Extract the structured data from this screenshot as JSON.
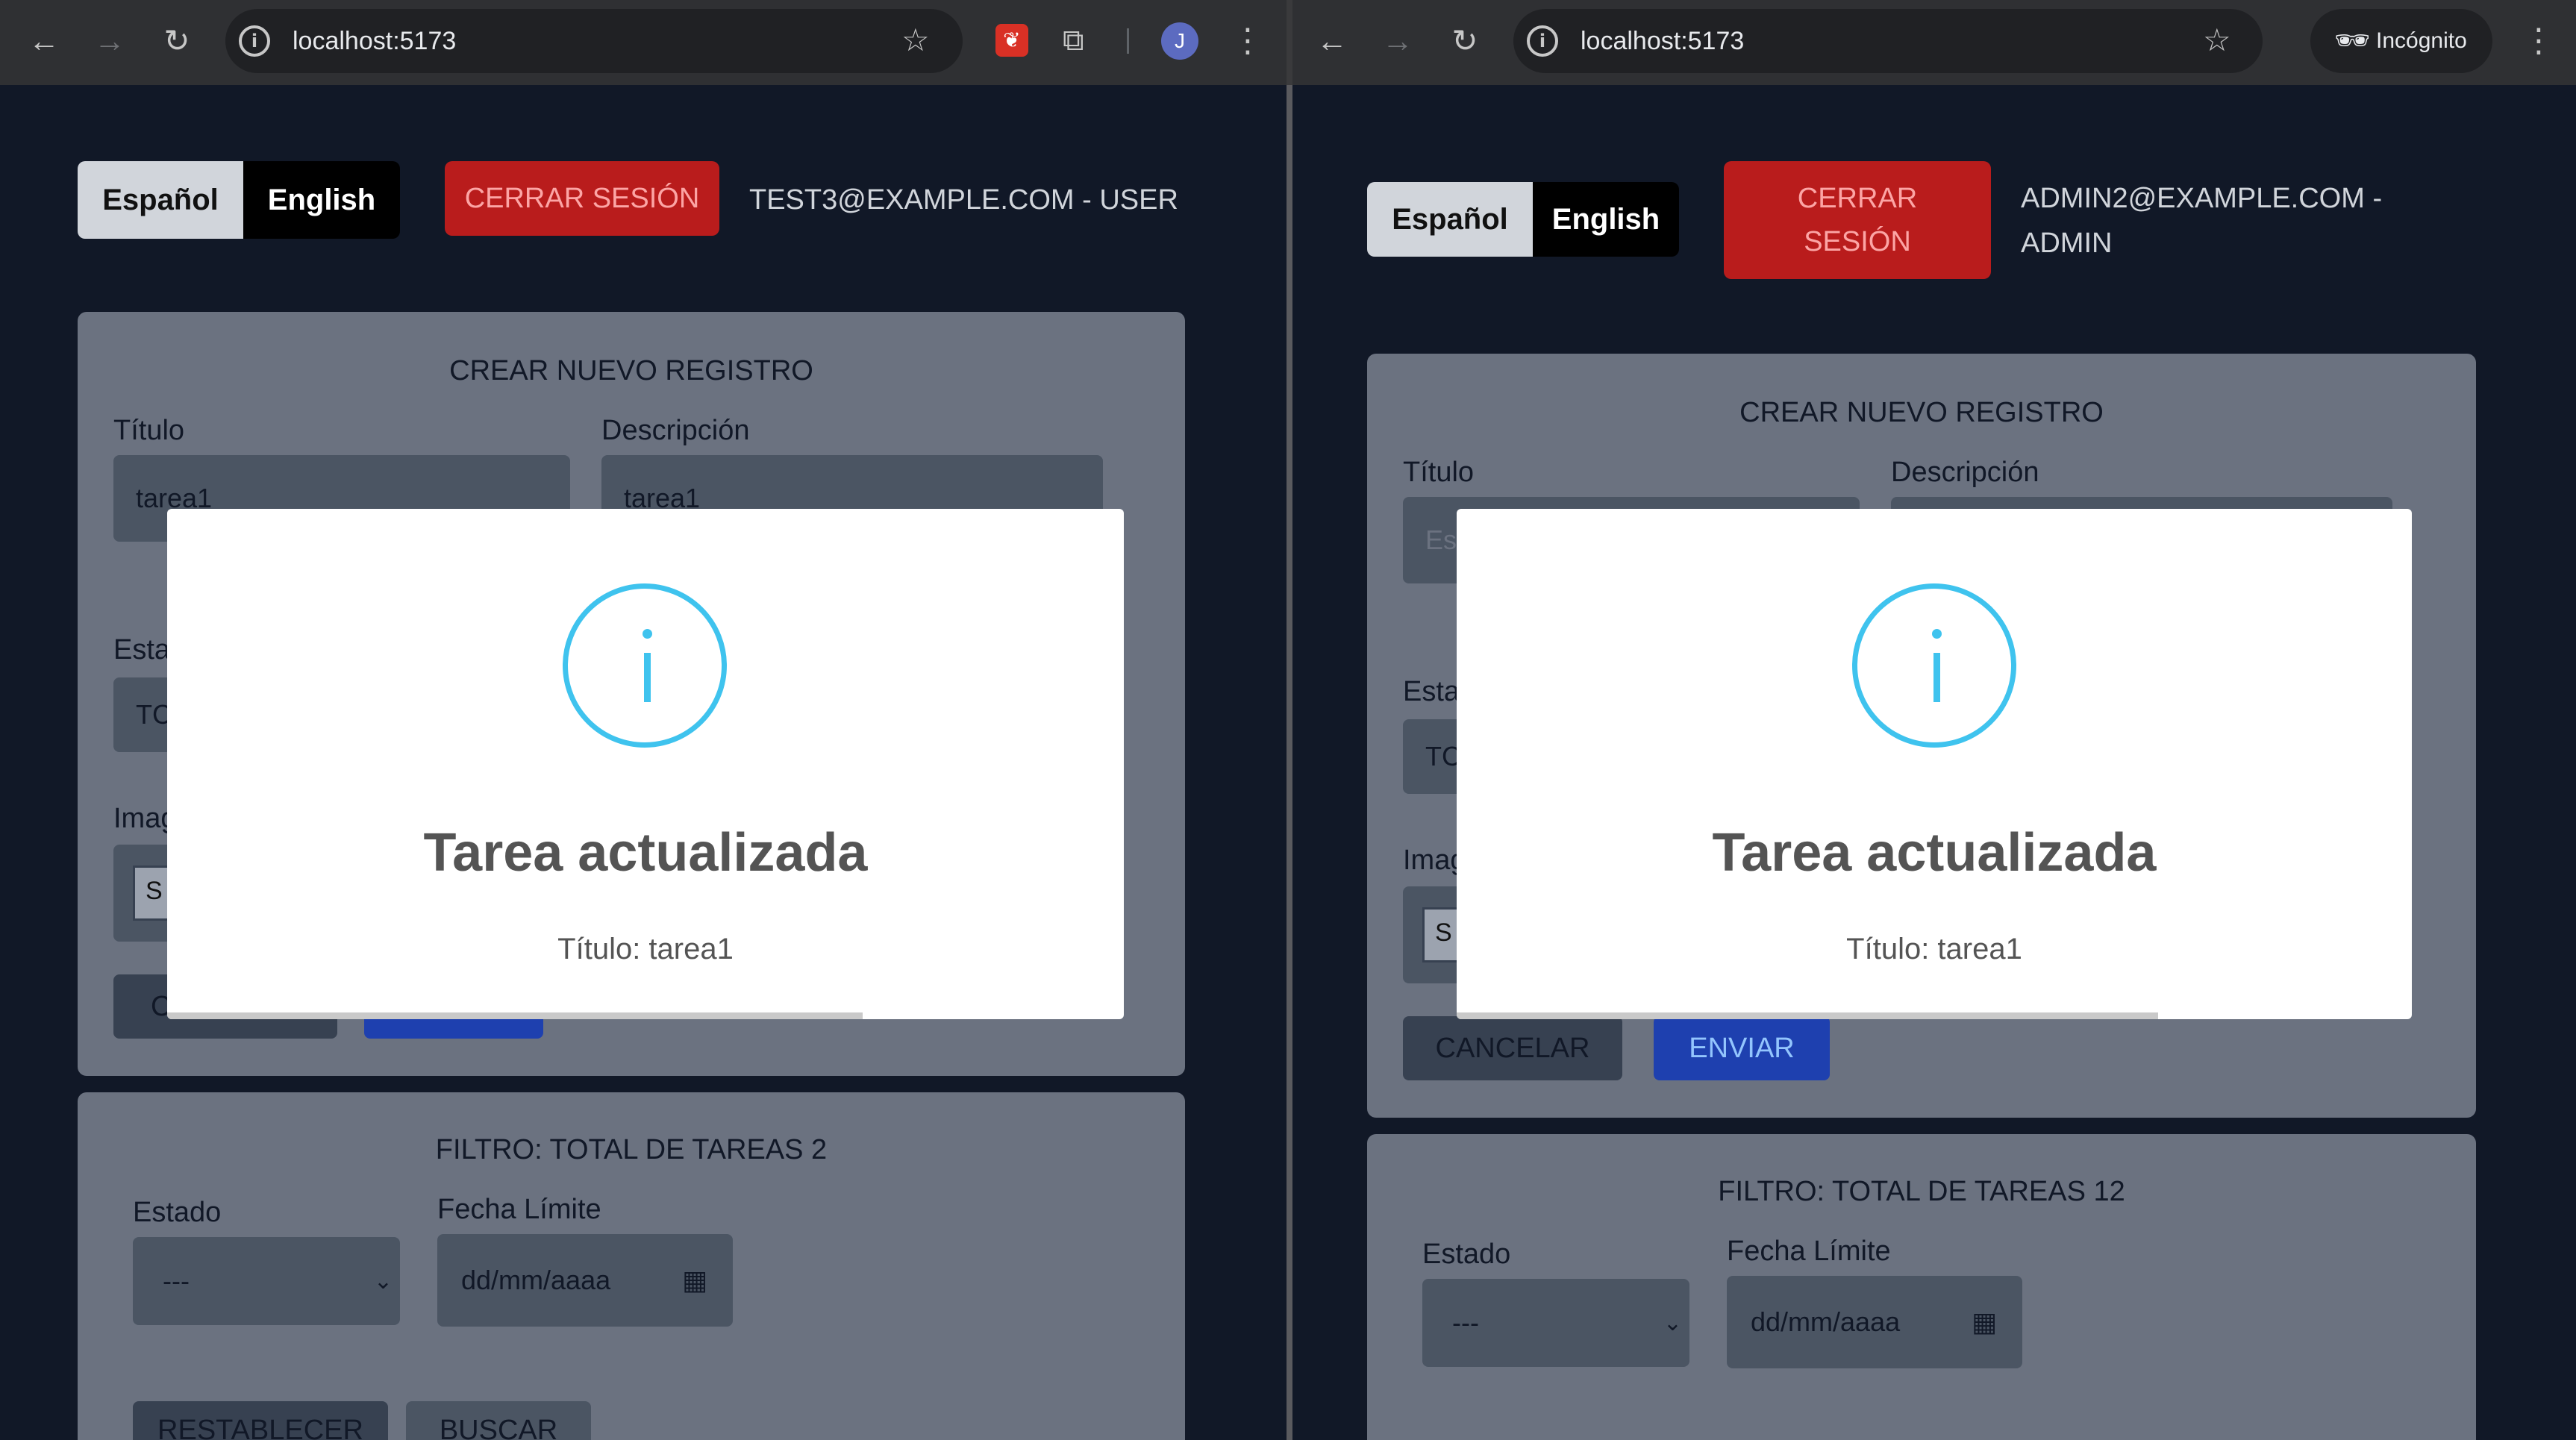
{
  "left": {
    "url": "localhost:5173",
    "profile_initial": "J",
    "lang_es": "Español",
    "lang_en": "English",
    "logout": "CERRAR SESIÓN",
    "user": "TEST3@EXAMPLE.COM - USER",
    "form": {
      "title": "CREAR NUEVO REGISTRO",
      "titulo_label": "Título",
      "titulo_value": "tarea1",
      "desc_label": "Descripción",
      "desc_value": "tarea1",
      "estado_label": "Esta",
      "estado_value": "TC",
      "imagen_label": "Imag",
      "file_btn": "S",
      "cancel_btn": "C"
    },
    "filter": {
      "title": "FILTRO: TOTAL DE TAREAS 2",
      "estado_label": "Estado",
      "estado_value": "---",
      "fecha_label": "Fecha Límite",
      "fecha_placeholder": "dd/mm/aaaa",
      "reset_btn": "RESTABLECER",
      "search_btn": "BUSCAR"
    },
    "modal": {
      "title": "Tarea actualizada",
      "text": "Título: tarea1"
    }
  },
  "right": {
    "url": "localhost:5173",
    "incognito": "Incógnito",
    "lang_es": "Español",
    "lang_en": "English",
    "logout_line1": "CERRAR",
    "logout_line2": "SESIÓN",
    "user_line1": "ADMIN2@EXAMPLE.COM -",
    "user_line2": "ADMIN",
    "form": {
      "title": "CREAR NUEVO REGISTRO",
      "titulo_label": "Título",
      "titulo_placeholder": "Es",
      "desc_label": "Descripción",
      "estado_label": "Esta",
      "estado_value": "TC",
      "imagen_label": "Imag",
      "file_btn": "S",
      "cancel_btn": "CANCELAR",
      "send_btn": "ENVIAR"
    },
    "filter": {
      "title": "FILTRO: TOTAL DE TAREAS 12",
      "estado_label": "Estado",
      "estado_value": "---",
      "fecha_label": "Fecha Límite",
      "fecha_placeholder": "dd/mm/aaaa"
    },
    "modal": {
      "title": "Tarea actualizada",
      "text": "Título: tarea1"
    }
  },
  "icons": {
    "back": "←",
    "forward": "→",
    "reload": "↻",
    "star": "☆",
    "menu": "⋮",
    "puzzle": "⧉",
    "extension": "❦",
    "incognito": "🕶",
    "chevron": "⌄",
    "calendar": "▦"
  },
  "colors": {
    "page_bg": "#111827",
    "logout_red": "#b91c1c",
    "info_icon": "#3fc3ee",
    "send_blue": "#1e40af"
  }
}
